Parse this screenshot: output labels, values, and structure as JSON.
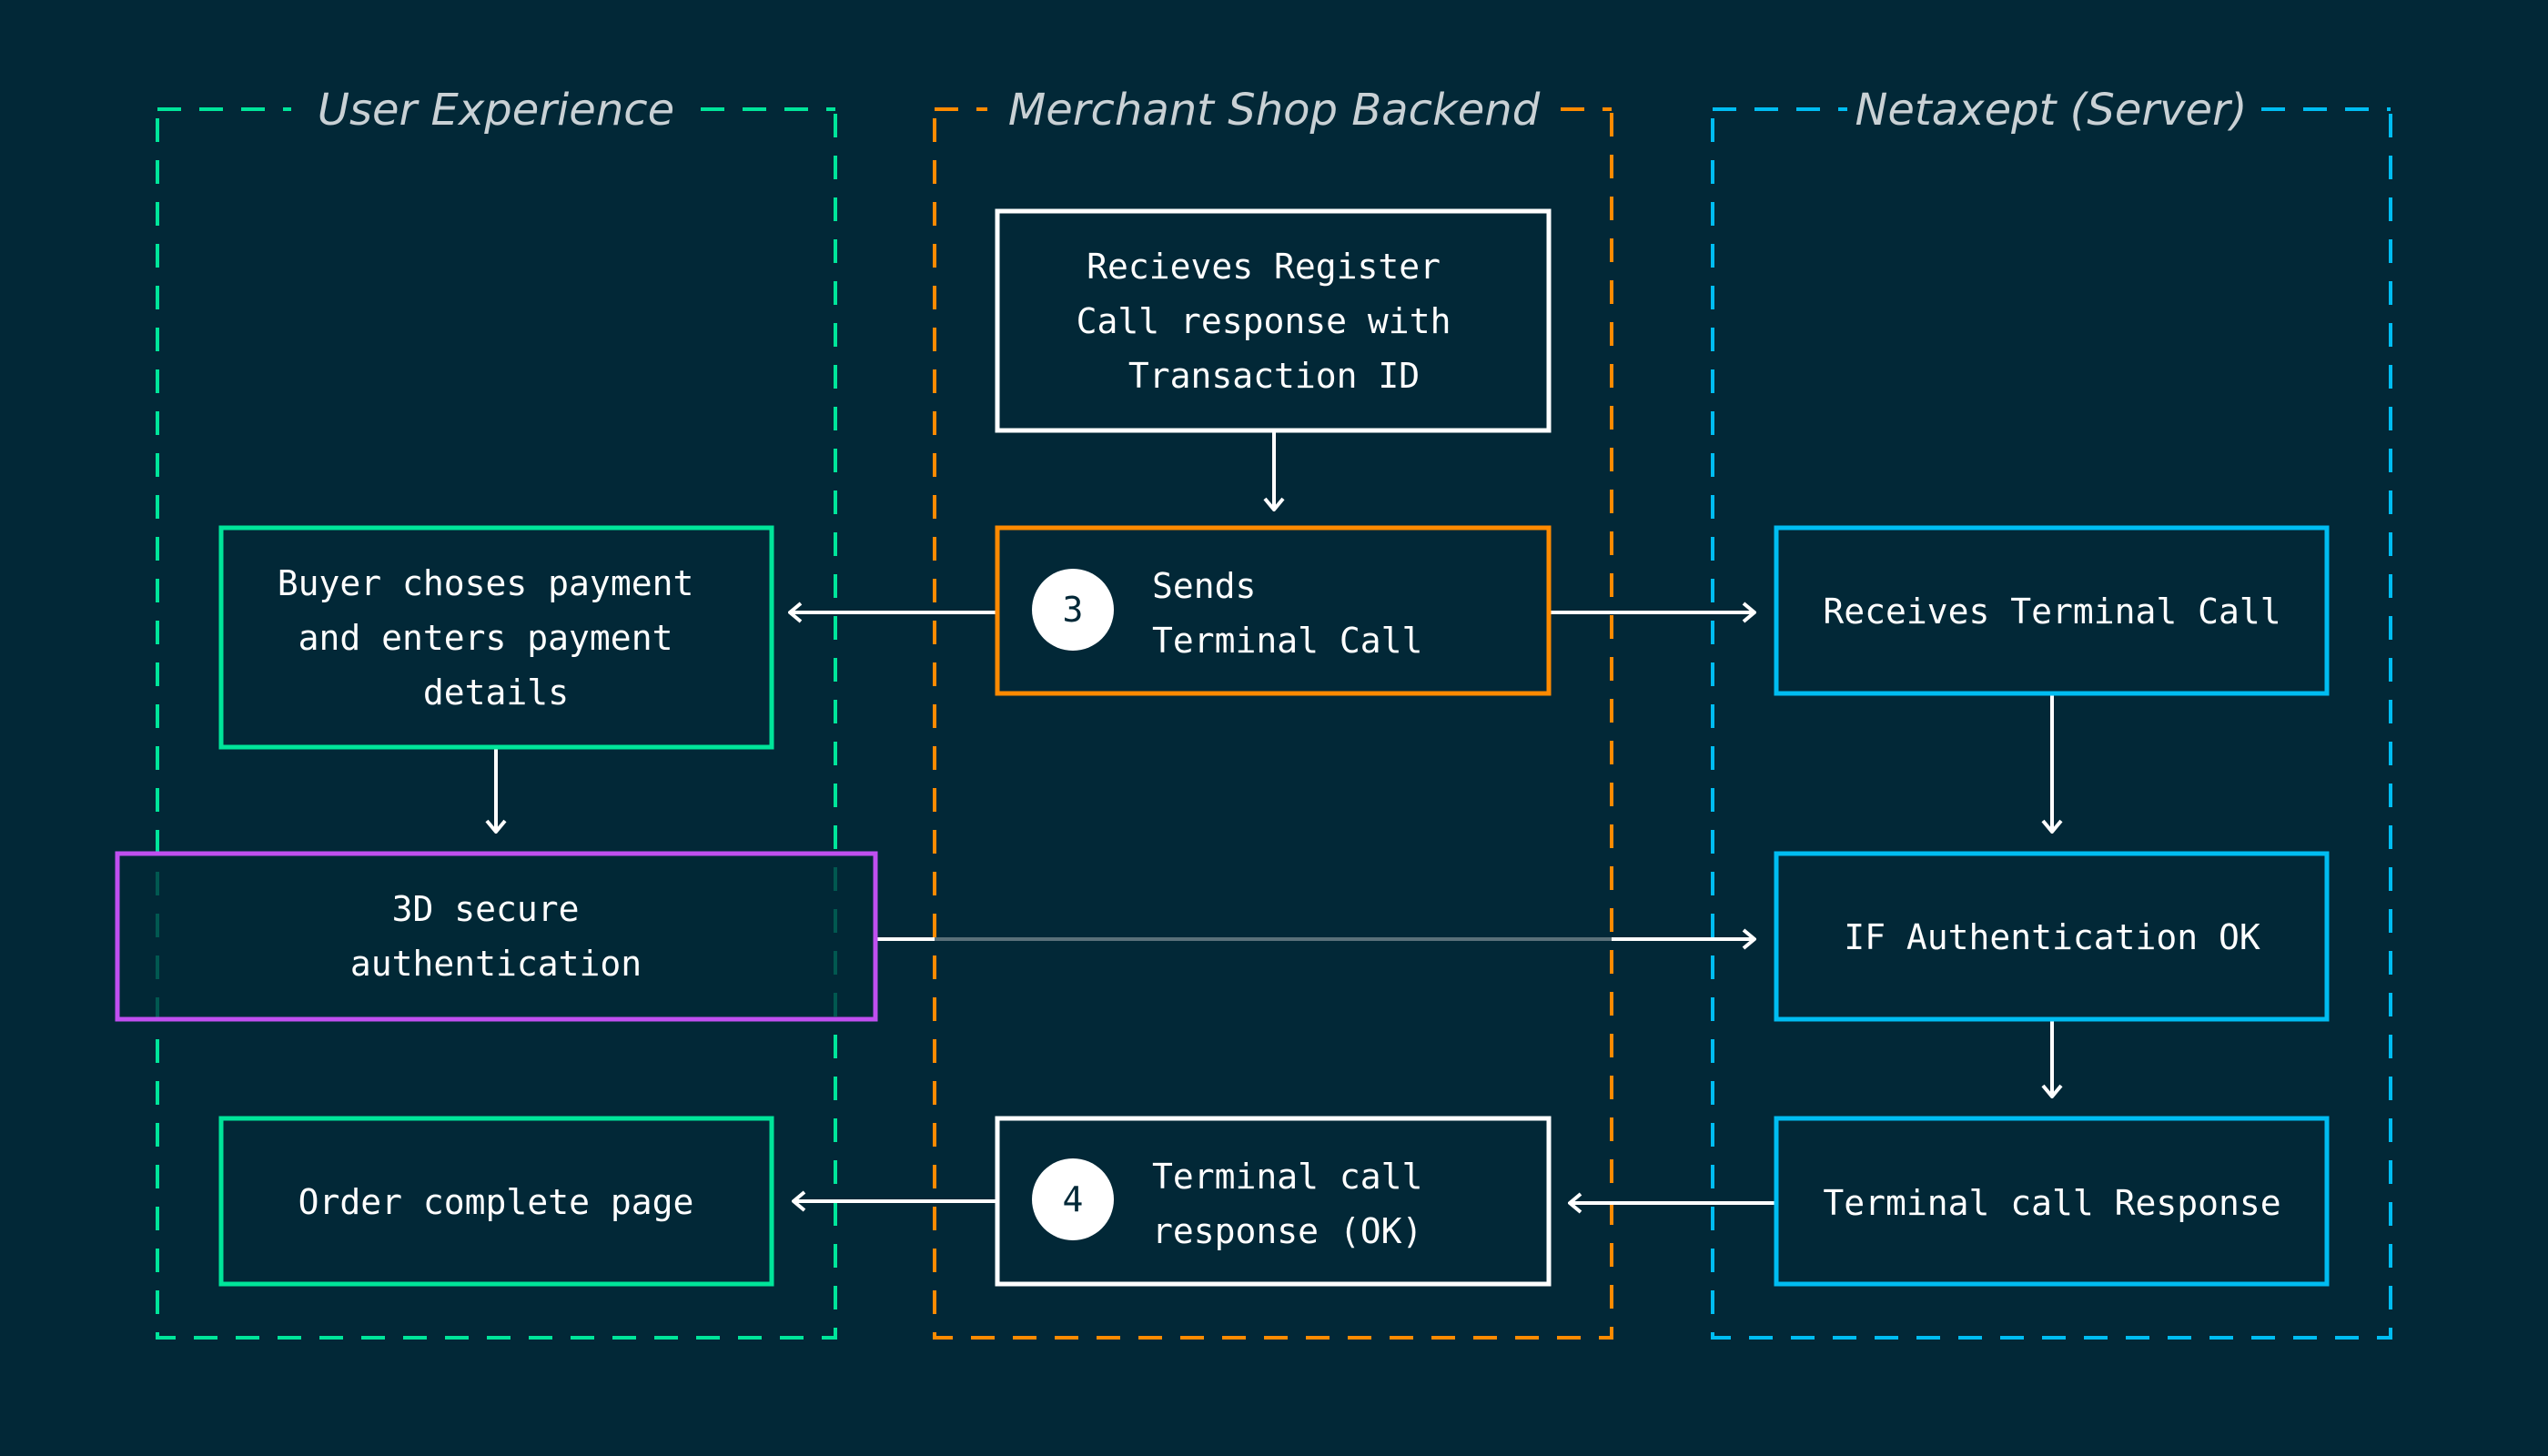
{
  "colors": {
    "background": "#022837",
    "user_experience": "#00e59a",
    "merchant": "#ff8a00",
    "netaxept": "#00bdf2",
    "secure": "#c04ff0",
    "neutral": "#ffffff"
  },
  "lanes": [
    {
      "title": "User Experience"
    },
    {
      "title": "Merchant Shop Backend"
    },
    {
      "title": "Netaxept (Server)"
    }
  ],
  "boxes": {
    "recieves_register": {
      "lines": [
        "Recieves Register",
        "Call response with",
        "Transaction ID"
      ]
    },
    "sends_terminal": {
      "step": "3",
      "lines": [
        "Sends",
        "Terminal Call"
      ]
    },
    "buyer_choses": {
      "lines": [
        "Buyer choses payment",
        "and enters payment",
        "details"
      ]
    },
    "secure_auth": {
      "lines": [
        "3D secure",
        "authentication"
      ]
    },
    "receives_terminal": {
      "lines": [
        "Receives Terminal Call"
      ]
    },
    "if_auth": {
      "lines": [
        "IF Authentication OK"
      ]
    },
    "terminal_response": {
      "lines": [
        "Terminal call Response"
      ]
    },
    "order_complete": {
      "lines": [
        "Order complete page"
      ]
    },
    "terminal_ok": {
      "step": "4",
      "lines": [
        "Terminal call",
        "response (OK)"
      ]
    }
  }
}
